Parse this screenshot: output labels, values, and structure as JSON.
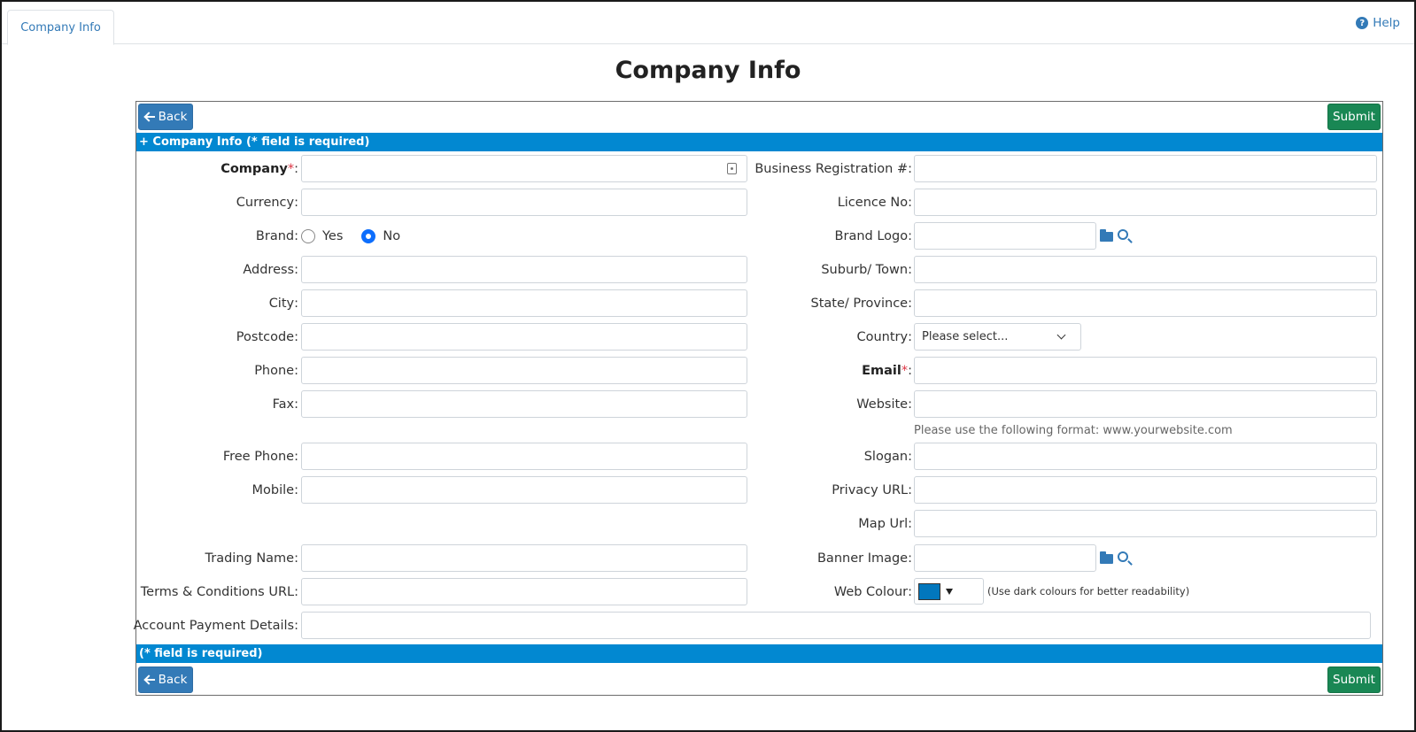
{
  "tabs": [
    {
      "label": "Company Info",
      "active": true
    }
  ],
  "help_label": "Help",
  "page_title": "Company Info",
  "buttons": {
    "back": "Back",
    "submit": "Submit"
  },
  "section_header": "+ Company Info (* field is required)",
  "footer_note": "(* field is required)",
  "left": {
    "company": "Company",
    "currency": "Currency",
    "brand": "Brand",
    "brand_yes": "Yes",
    "brand_no": "No",
    "brand_selected": "No",
    "address": "Address",
    "city": "City",
    "postcode": "Postcode",
    "phone": "Phone",
    "fax": "Fax",
    "free_phone": "Free Phone",
    "mobile": "Mobile",
    "trading_name": "Trading Name",
    "terms_url": "Terms & Conditions URL",
    "account_payment": "Account Payment Details"
  },
  "right": {
    "business_reg": "Business Registration #",
    "licence_no": "Licence No",
    "brand_logo": "Brand Logo",
    "suburb": "Suburb/ Town",
    "state": "State/ Province",
    "country": "Country",
    "country_value": "Please select...",
    "email": "Email",
    "website": "Website",
    "website_hint": "Please use the following format: www.yourwebsite.com",
    "slogan": "Slogan",
    "privacy_url": "Privacy URL",
    "map_url": "Map Url",
    "banner_image": "Banner Image",
    "web_colour": "Web Colour",
    "web_colour_value": "#0277bd",
    "web_colour_hint": "(Use dark colours for better readability)"
  },
  "required_mark": "*",
  "label_suffix": " :"
}
